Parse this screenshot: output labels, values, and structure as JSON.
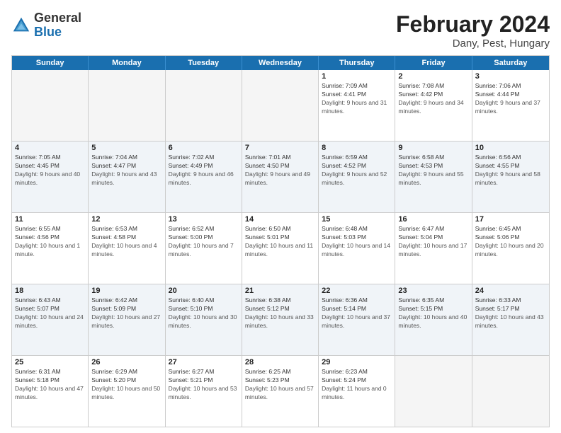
{
  "logo": {
    "text_general": "General",
    "text_blue": "Blue"
  },
  "header": {
    "title": "February 2024",
    "subtitle": "Dany, Pest, Hungary"
  },
  "weekdays": [
    "Sunday",
    "Monday",
    "Tuesday",
    "Wednesday",
    "Thursday",
    "Friday",
    "Saturday"
  ],
  "rows": [
    [
      {
        "day": "",
        "sunrise": "",
        "sunset": "",
        "daylight": "",
        "empty": true
      },
      {
        "day": "",
        "sunrise": "",
        "sunset": "",
        "daylight": "",
        "empty": true
      },
      {
        "day": "",
        "sunrise": "",
        "sunset": "",
        "daylight": "",
        "empty": true
      },
      {
        "day": "",
        "sunrise": "",
        "sunset": "",
        "daylight": "",
        "empty": true
      },
      {
        "day": "1",
        "sunrise": "7:09 AM",
        "sunset": "4:41 PM",
        "daylight": "9 hours and 31 minutes.",
        "empty": false
      },
      {
        "day": "2",
        "sunrise": "7:08 AM",
        "sunset": "4:42 PM",
        "daylight": "9 hours and 34 minutes.",
        "empty": false
      },
      {
        "day": "3",
        "sunrise": "7:06 AM",
        "sunset": "4:44 PM",
        "daylight": "9 hours and 37 minutes.",
        "empty": false
      }
    ],
    [
      {
        "day": "4",
        "sunrise": "7:05 AM",
        "sunset": "4:45 PM",
        "daylight": "9 hours and 40 minutes.",
        "empty": false
      },
      {
        "day": "5",
        "sunrise": "7:04 AM",
        "sunset": "4:47 PM",
        "daylight": "9 hours and 43 minutes.",
        "empty": false
      },
      {
        "day": "6",
        "sunrise": "7:02 AM",
        "sunset": "4:49 PM",
        "daylight": "9 hours and 46 minutes.",
        "empty": false
      },
      {
        "day": "7",
        "sunrise": "7:01 AM",
        "sunset": "4:50 PM",
        "daylight": "9 hours and 49 minutes.",
        "empty": false
      },
      {
        "day": "8",
        "sunrise": "6:59 AM",
        "sunset": "4:52 PM",
        "daylight": "9 hours and 52 minutes.",
        "empty": false
      },
      {
        "day": "9",
        "sunrise": "6:58 AM",
        "sunset": "4:53 PM",
        "daylight": "9 hours and 55 minutes.",
        "empty": false
      },
      {
        "day": "10",
        "sunrise": "6:56 AM",
        "sunset": "4:55 PM",
        "daylight": "9 hours and 58 minutes.",
        "empty": false
      }
    ],
    [
      {
        "day": "11",
        "sunrise": "6:55 AM",
        "sunset": "4:56 PM",
        "daylight": "10 hours and 1 minute.",
        "empty": false
      },
      {
        "day": "12",
        "sunrise": "6:53 AM",
        "sunset": "4:58 PM",
        "daylight": "10 hours and 4 minutes.",
        "empty": false
      },
      {
        "day": "13",
        "sunrise": "6:52 AM",
        "sunset": "5:00 PM",
        "daylight": "10 hours and 7 minutes.",
        "empty": false
      },
      {
        "day": "14",
        "sunrise": "6:50 AM",
        "sunset": "5:01 PM",
        "daylight": "10 hours and 11 minutes.",
        "empty": false
      },
      {
        "day": "15",
        "sunrise": "6:48 AM",
        "sunset": "5:03 PM",
        "daylight": "10 hours and 14 minutes.",
        "empty": false
      },
      {
        "day": "16",
        "sunrise": "6:47 AM",
        "sunset": "5:04 PM",
        "daylight": "10 hours and 17 minutes.",
        "empty": false
      },
      {
        "day": "17",
        "sunrise": "6:45 AM",
        "sunset": "5:06 PM",
        "daylight": "10 hours and 20 minutes.",
        "empty": false
      }
    ],
    [
      {
        "day": "18",
        "sunrise": "6:43 AM",
        "sunset": "5:07 PM",
        "daylight": "10 hours and 24 minutes.",
        "empty": false
      },
      {
        "day": "19",
        "sunrise": "6:42 AM",
        "sunset": "5:09 PM",
        "daylight": "10 hours and 27 minutes.",
        "empty": false
      },
      {
        "day": "20",
        "sunrise": "6:40 AM",
        "sunset": "5:10 PM",
        "daylight": "10 hours and 30 minutes.",
        "empty": false
      },
      {
        "day": "21",
        "sunrise": "6:38 AM",
        "sunset": "5:12 PM",
        "daylight": "10 hours and 33 minutes.",
        "empty": false
      },
      {
        "day": "22",
        "sunrise": "6:36 AM",
        "sunset": "5:14 PM",
        "daylight": "10 hours and 37 minutes.",
        "empty": false
      },
      {
        "day": "23",
        "sunrise": "6:35 AM",
        "sunset": "5:15 PM",
        "daylight": "10 hours and 40 minutes.",
        "empty": false
      },
      {
        "day": "24",
        "sunrise": "6:33 AM",
        "sunset": "5:17 PM",
        "daylight": "10 hours and 43 minutes.",
        "empty": false
      }
    ],
    [
      {
        "day": "25",
        "sunrise": "6:31 AM",
        "sunset": "5:18 PM",
        "daylight": "10 hours and 47 minutes.",
        "empty": false
      },
      {
        "day": "26",
        "sunrise": "6:29 AM",
        "sunset": "5:20 PM",
        "daylight": "10 hours and 50 minutes.",
        "empty": false
      },
      {
        "day": "27",
        "sunrise": "6:27 AM",
        "sunset": "5:21 PM",
        "daylight": "10 hours and 53 minutes.",
        "empty": false
      },
      {
        "day": "28",
        "sunrise": "6:25 AM",
        "sunset": "5:23 PM",
        "daylight": "10 hours and 57 minutes.",
        "empty": false
      },
      {
        "day": "29",
        "sunrise": "6:23 AM",
        "sunset": "5:24 PM",
        "daylight": "11 hours and 0 minutes.",
        "empty": false
      },
      {
        "day": "",
        "sunrise": "",
        "sunset": "",
        "daylight": "",
        "empty": true
      },
      {
        "day": "",
        "sunrise": "",
        "sunset": "",
        "daylight": "",
        "empty": true
      }
    ]
  ]
}
